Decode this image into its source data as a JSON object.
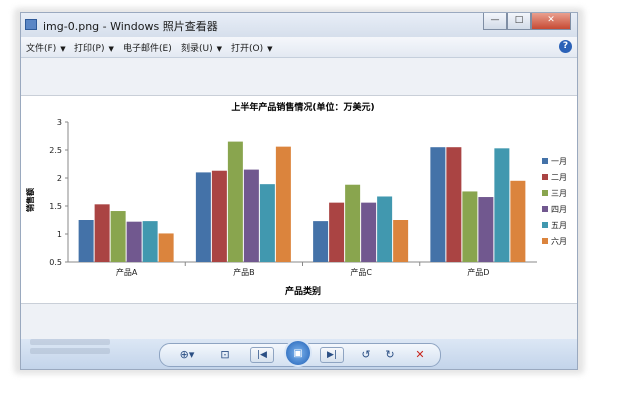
{
  "window": {
    "title": "img-0.png - Windows 照片查看器",
    "buttons": {
      "minimize": "—",
      "maximize": "□",
      "close": "✕"
    }
  },
  "menubar": {
    "items": [
      {
        "label": "文件(F)",
        "has_arrow": true
      },
      {
        "label": "打印(P)",
        "has_arrow": true
      },
      {
        "label": "电子邮件(E)",
        "has_arrow": false
      },
      {
        "label": "刻录(U)",
        "has_arrow": true
      },
      {
        "label": "打开(O)",
        "has_arrow": true
      }
    ],
    "arrow_glyph": "▼",
    "help_glyph": "?"
  },
  "toolbar": {
    "zoom_glyph": "⊕▾",
    "fit_glyph": "⊡",
    "prev_glyph": "|◀",
    "slideshow_glyph": "▣",
    "next_glyph": "▶|",
    "rotate_ccw_glyph": "↺",
    "rotate_cw_glyph": "↻",
    "delete_glyph": "✕"
  },
  "colors": {
    "series": [
      "#4472a8",
      "#aa4443",
      "#89a54e",
      "#71588f",
      "#4198af",
      "#db843d"
    ],
    "axis": "#888888",
    "title": "#000000"
  },
  "chart_data": {
    "type": "bar",
    "title": "上半年产品销售情况(单位：万美元)",
    "xlabel": "产品类别",
    "ylabel": "销售额",
    "ylim": [
      0.5,
      3
    ],
    "yticks": [
      "0.5",
      "1",
      "1.5",
      "2",
      "2.5",
      "3"
    ],
    "ytick_values": [
      0.5,
      1,
      1.5,
      2,
      2.5,
      3
    ],
    "categories": [
      "产品A",
      "产品B",
      "产品C",
      "产品D"
    ],
    "legend_position": "right",
    "grid": false,
    "series": [
      {
        "name": "一月",
        "values": [
          1.25,
          2.1,
          1.23,
          2.55
        ]
      },
      {
        "name": "二月",
        "values": [
          1.53,
          2.13,
          1.56,
          2.55
        ]
      },
      {
        "name": "三月",
        "values": [
          1.41,
          2.65,
          1.88,
          1.76
        ]
      },
      {
        "name": "四月",
        "values": [
          1.22,
          2.15,
          1.56,
          1.66
        ]
      },
      {
        "name": "五月",
        "values": [
          1.23,
          1.89,
          1.67,
          2.53
        ]
      },
      {
        "name": "六月",
        "values": [
          1.01,
          2.56,
          1.25,
          1.95
        ]
      }
    ]
  }
}
